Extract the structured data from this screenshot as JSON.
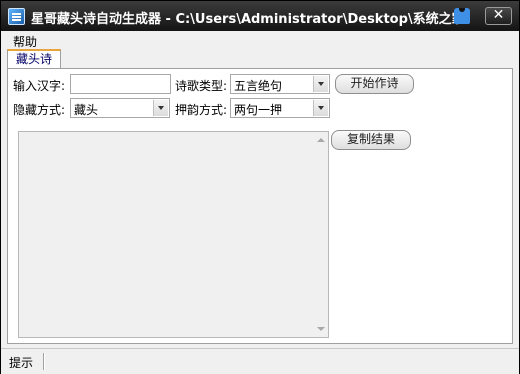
{
  "window": {
    "title": "星哥藏头诗自动生成器 - C:\\Users\\Administrator\\Desktop\\系统之家",
    "close_glyph": "✕"
  },
  "menu": {
    "items": [
      {
        "label": "帮助"
      }
    ]
  },
  "tabs": [
    {
      "label": "藏头诗",
      "active": true
    }
  ],
  "form": {
    "input_label": "输入汉字:",
    "input_value": "",
    "poem_type_label": "诗歌类型:",
    "poem_type_value": "五言绝句",
    "hide_mode_label": "隐藏方式:",
    "hide_mode_value": "藏头",
    "rhyme_mode_label": "押韵方式:",
    "rhyme_mode_value": "两句一押",
    "start_button": "开始作诗",
    "copy_button": "复制结果",
    "result_text": ""
  },
  "status": {
    "label": "提示"
  },
  "colors": {
    "titlebar": "#141414",
    "tab_accent": "#e8a33c",
    "tab_text": "#000066"
  }
}
